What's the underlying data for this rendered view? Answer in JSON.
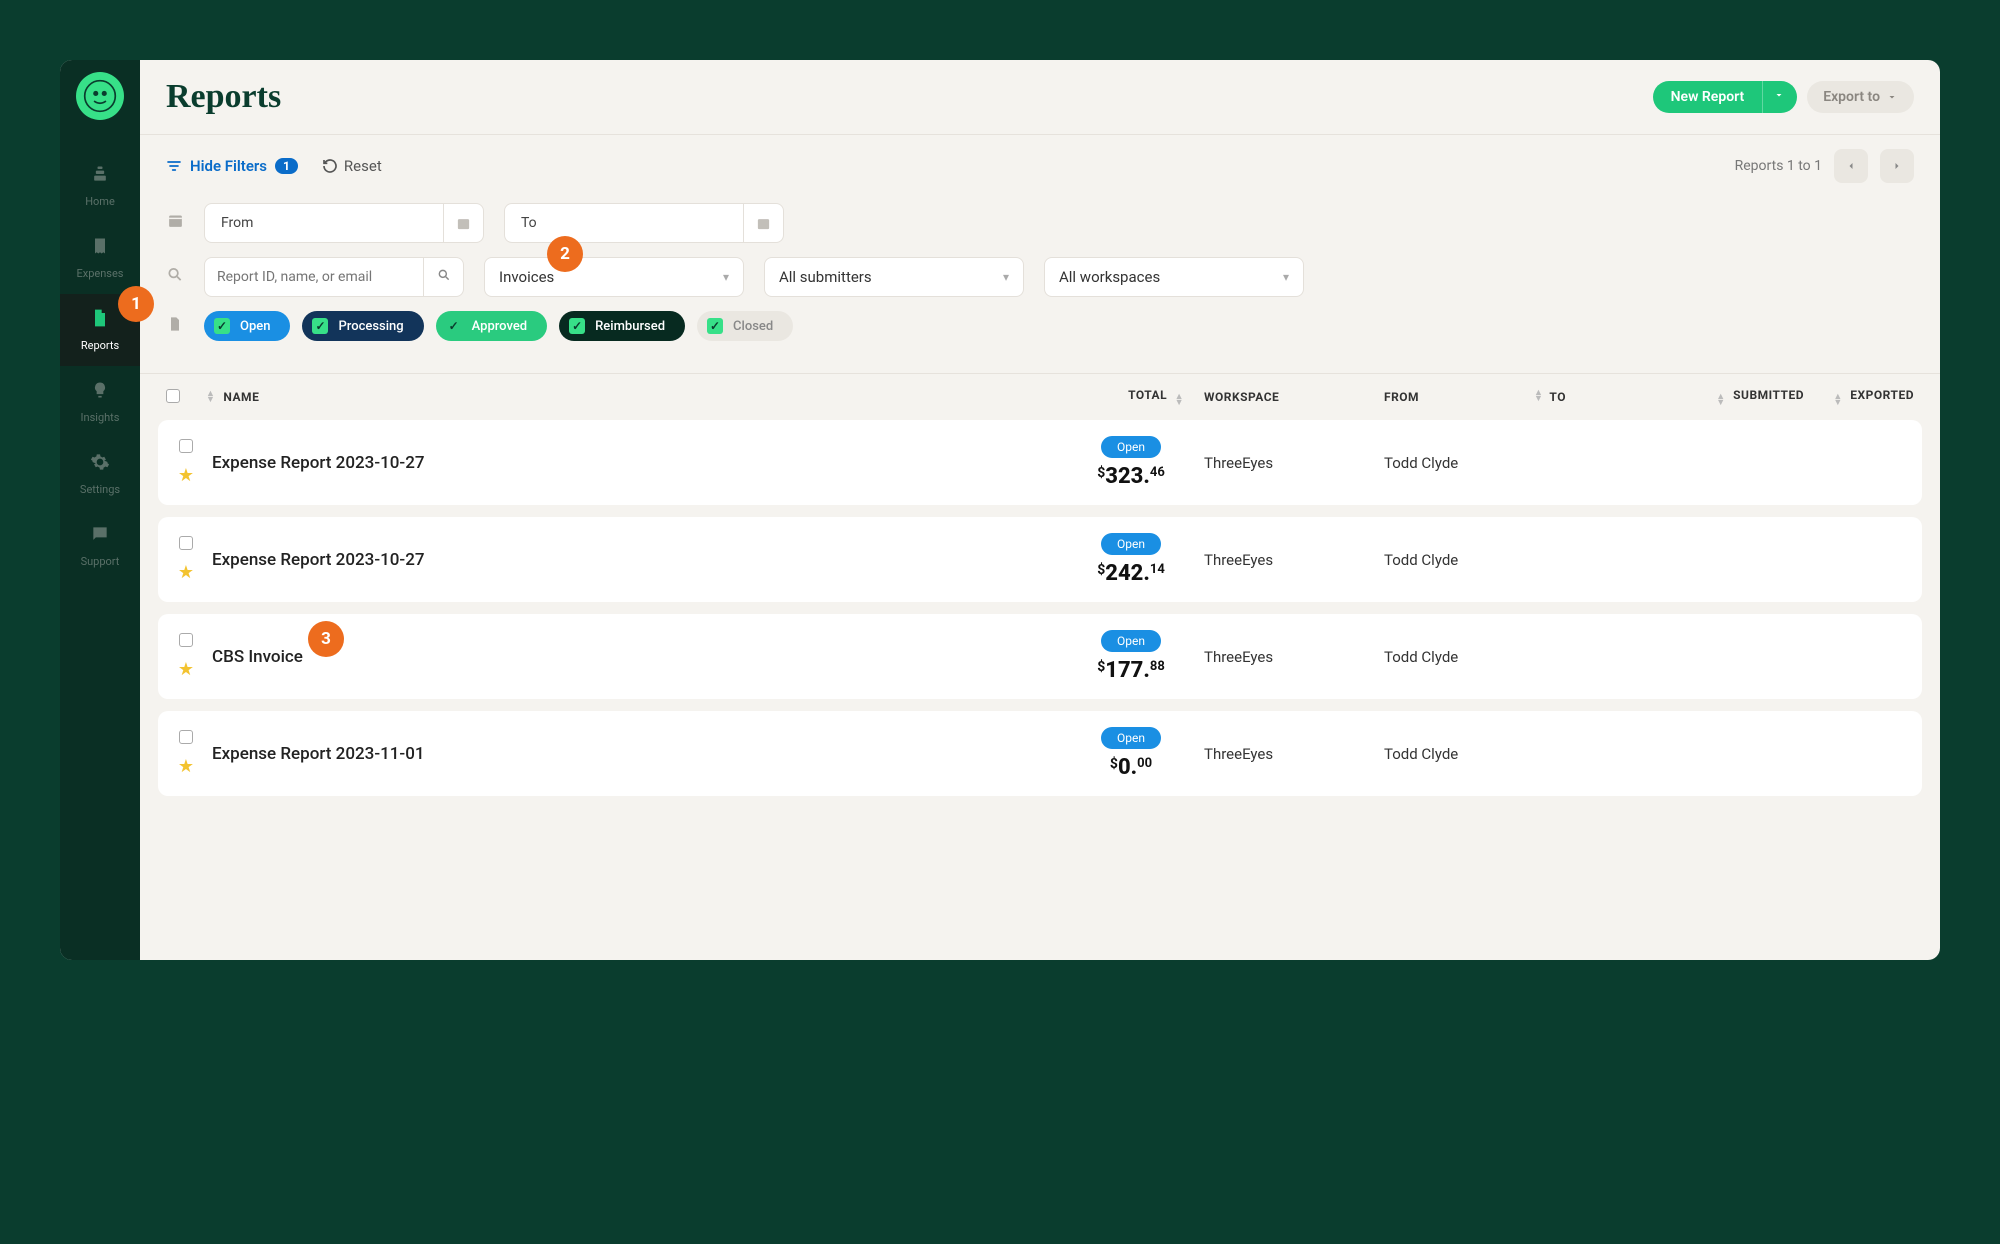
{
  "page_title": "Reports",
  "header": {
    "new_report": "New Report",
    "export_to": "Export to"
  },
  "sidebar": {
    "items": [
      {
        "label": "Home"
      },
      {
        "label": "Expenses"
      },
      {
        "label": "Reports"
      },
      {
        "label": "Insights"
      },
      {
        "label": "Settings"
      },
      {
        "label": "Support"
      }
    ]
  },
  "filter_bar": {
    "hide_filters": "Hide Filters",
    "filter_count": "1",
    "reset": "Reset",
    "results_text": "Reports 1 to 1"
  },
  "filters": {
    "from_label": "From",
    "to_label": "To",
    "search_placeholder": "Report ID, name, or email",
    "type_select": "Invoices",
    "submitter_select": "All submitters",
    "workspace_select": "All workspaces",
    "statuses": {
      "open": "Open",
      "processing": "Processing",
      "approved": "Approved",
      "reimbursed": "Reimbursed",
      "closed": "Closed"
    }
  },
  "table": {
    "headers": {
      "name": "NAME",
      "total": "TOTAL",
      "workspace": "WORKSPACE",
      "from": "FROM",
      "to": "TO",
      "submitted": "SUBMITTED",
      "exported": "EXPORTED"
    },
    "rows": [
      {
        "name": "Expense Report 2023-10-27",
        "status": "Open",
        "amount_whole": "323",
        "amount_cents": "46",
        "workspace": "ThreeEyes",
        "from": "Todd Clyde"
      },
      {
        "name": "Expense Report 2023-10-27",
        "status": "Open",
        "amount_whole": "242",
        "amount_cents": "14",
        "workspace": "ThreeEyes",
        "from": "Todd Clyde"
      },
      {
        "name": "CBS Invoice",
        "status": "Open",
        "amount_whole": "177",
        "amount_cents": "88",
        "workspace": "ThreeEyes",
        "from": "Todd Clyde"
      },
      {
        "name": "Expense Report 2023-11-01",
        "status": "Open",
        "amount_whole": "0",
        "amount_cents": "00",
        "workspace": "ThreeEyes",
        "from": "Todd Clyde"
      }
    ]
  },
  "callouts": {
    "c1": "1",
    "c2": "2",
    "c3": "3"
  }
}
